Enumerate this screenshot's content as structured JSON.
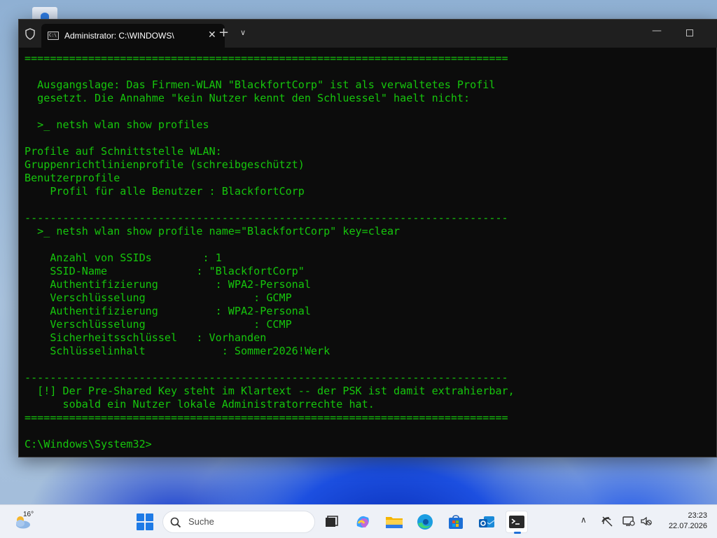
{
  "window": {
    "tab_title": "Administrator: C:\\WINDOWS\\",
    "tab_icon_text": "C:\\",
    "close_glyph": "✕",
    "new_tab_glyph": "+",
    "dropdown_glyph": "∨",
    "minimize_glyph": "—"
  },
  "console": {
    "lines": [
      "============================================================================",
      "",
      "  Ausgangslage: Das Firmen-WLAN \"BlackfortCorp\" ist als verwaltetes Profil",
      "  gesetzt. Die Annahme \"kein Nutzer kennt den Schluessel\" haelt nicht:",
      "",
      "  >_ netsh wlan show profiles",
      "",
      "Profile auf Schnittstelle WLAN:",
      "Gruppenrichtlinienprofile (schreibgeschützt)",
      "Benutzerprofile",
      "    Profil für alle Benutzer : BlackfortCorp",
      "",
      "----------------------------------------------------------------------------",
      "  >_ netsh wlan show profile name=\"BlackfortCorp\" key=clear",
      "",
      "    Anzahl von SSIDs        : 1",
      "    SSID-Name              : \"BlackfortCorp\"",
      "    Authentifizierung         : WPA2-Personal",
      "    Verschlüsselung                 : GCMP",
      "    Authentifizierung         : WPA2-Personal",
      "    Verschlüsselung                 : CCMP",
      "    Sicherheitsschlüssel   : Vorhanden",
      "    Schlüsselinhalt            : Sommer2026!Werk",
      "",
      "----------------------------------------------------------------------------",
      "  [!] Der Pre-Shared Key steht im Klartext -- der PSK ist damit extrahierbar,",
      "      sobald ein Nutzer lokale Administratorrechte hat.",
      "============================================================================",
      "",
      "C:\\Windows\\System32>"
    ],
    "text_color": "#16c60c",
    "background": "#0c0c0c"
  },
  "taskbar": {
    "weather_temp": "16°",
    "search_placeholder": "Suche",
    "clock_time": "23:23",
    "clock_date": "22.07.2026",
    "tray_chevron": "∧",
    "apps": [
      {
        "name": "task-view",
        "icon": "task-view-icon"
      },
      {
        "name": "copilot",
        "icon": "copilot-icon"
      },
      {
        "name": "file-explorer",
        "icon": "folder-icon"
      },
      {
        "name": "edge",
        "icon": "edge-icon"
      },
      {
        "name": "store",
        "icon": "store-icon"
      },
      {
        "name": "outlook",
        "icon": "outlook-icon"
      },
      {
        "name": "terminal",
        "icon": "terminal-icon",
        "active": true
      }
    ]
  }
}
